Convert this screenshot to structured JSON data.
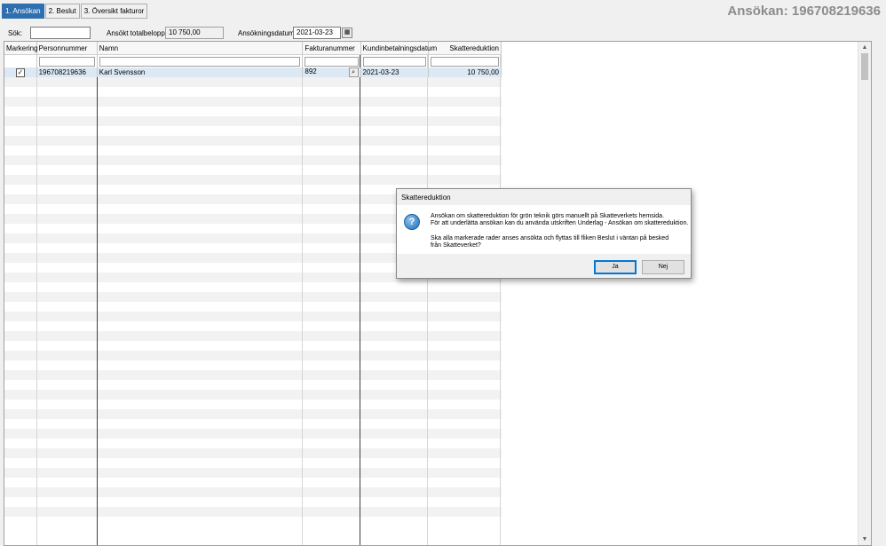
{
  "tabs": [
    {
      "label": "1. Ansökan"
    },
    {
      "label": "2. Beslut"
    },
    {
      "label": "3. Översikt fakturor"
    }
  ],
  "app_title": "Ansökan: 196708219636",
  "toolbar": {
    "search_label": "Sök:",
    "search_value": "",
    "total_label": "Ansökt totalbelopp:",
    "total_value": "10 750,00",
    "date_label": "Ansökningsdatum:",
    "date_value": "2021-03-23"
  },
  "grid": {
    "columns": [
      "Markering",
      "Personnummer",
      "Namn",
      "Fakturanummer",
      "Kundinbetalningsdatum",
      "Skattereduktion"
    ],
    "rows": [
      {
        "checked": true,
        "personnummer": "196708219636",
        "namn": "Karl Svensson",
        "fakturanummer": "892",
        "kundinbetalningsdatum": "2021-03-23",
        "skattereduktion": "10 750,00"
      }
    ]
  },
  "dialog": {
    "title": "Skattereduktion",
    "icon": "question-icon",
    "message_line1": "Ansökan om skattereduktion för grön teknik görs manuellt på Skatteverkets hemsida.",
    "message_line2": "För att underlätta ansökan kan du använda utskriften Underlag - Ansökan om skattereduktion.",
    "message_line3": "Ska alla markerade rader anses ansökta och flyttas till fliken Beslut i väntan på besked",
    "message_line4": "från Skatteverket?",
    "yes_label": "Ja",
    "no_label": "Nej"
  }
}
